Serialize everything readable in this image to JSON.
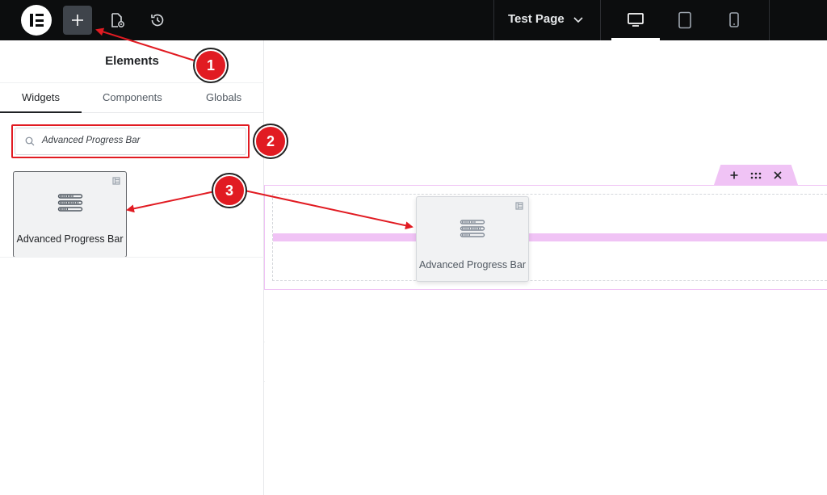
{
  "topbar": {
    "logo_icon": "elementor-logo-icon",
    "add_icon": "plus-icon",
    "page_settings_icon": "page-settings-icon",
    "history_icon": "history-icon",
    "page_title": "Test Page",
    "page_title_icon": "chevron-down-icon",
    "devices": [
      {
        "name": "desktop",
        "icon": "desktop-icon",
        "active": true
      },
      {
        "name": "tablet",
        "icon": "tablet-icon",
        "active": false
      },
      {
        "name": "mobile",
        "icon": "mobile-icon",
        "active": false
      }
    ]
  },
  "panel": {
    "title": "Elements",
    "tabs": [
      {
        "label": "Widgets",
        "active": true
      },
      {
        "label": "Components",
        "active": false
      },
      {
        "label": "Globals",
        "active": false
      }
    ],
    "search": {
      "value": "Advanced Progress Bar",
      "icon": "search-icon"
    },
    "widget": {
      "label": "Advanced Progress Bar",
      "icon": "progress-bar-icon",
      "badge_icon": "element-pack-badge-icon"
    },
    "collapse_icon": "chevron-left-icon"
  },
  "canvas": {
    "section_controls": [
      {
        "name": "add",
        "icon": "plus-icon"
      },
      {
        "name": "move",
        "icon": "drag-handle-icon"
      },
      {
        "name": "delete",
        "icon": "close-icon"
      }
    ],
    "dragged_widget": {
      "label": "Advanced Progress Bar",
      "icon": "progress-bar-icon",
      "badge_icon": "element-pack-badge-icon"
    }
  },
  "annotations": {
    "steps": [
      "1",
      "2",
      "3"
    ],
    "color": "#e11b22"
  },
  "colors": {
    "topbar_bg": "#0c0d0e",
    "highlight_pink": "#f0c3f5",
    "annotation_red": "#e11b22"
  }
}
